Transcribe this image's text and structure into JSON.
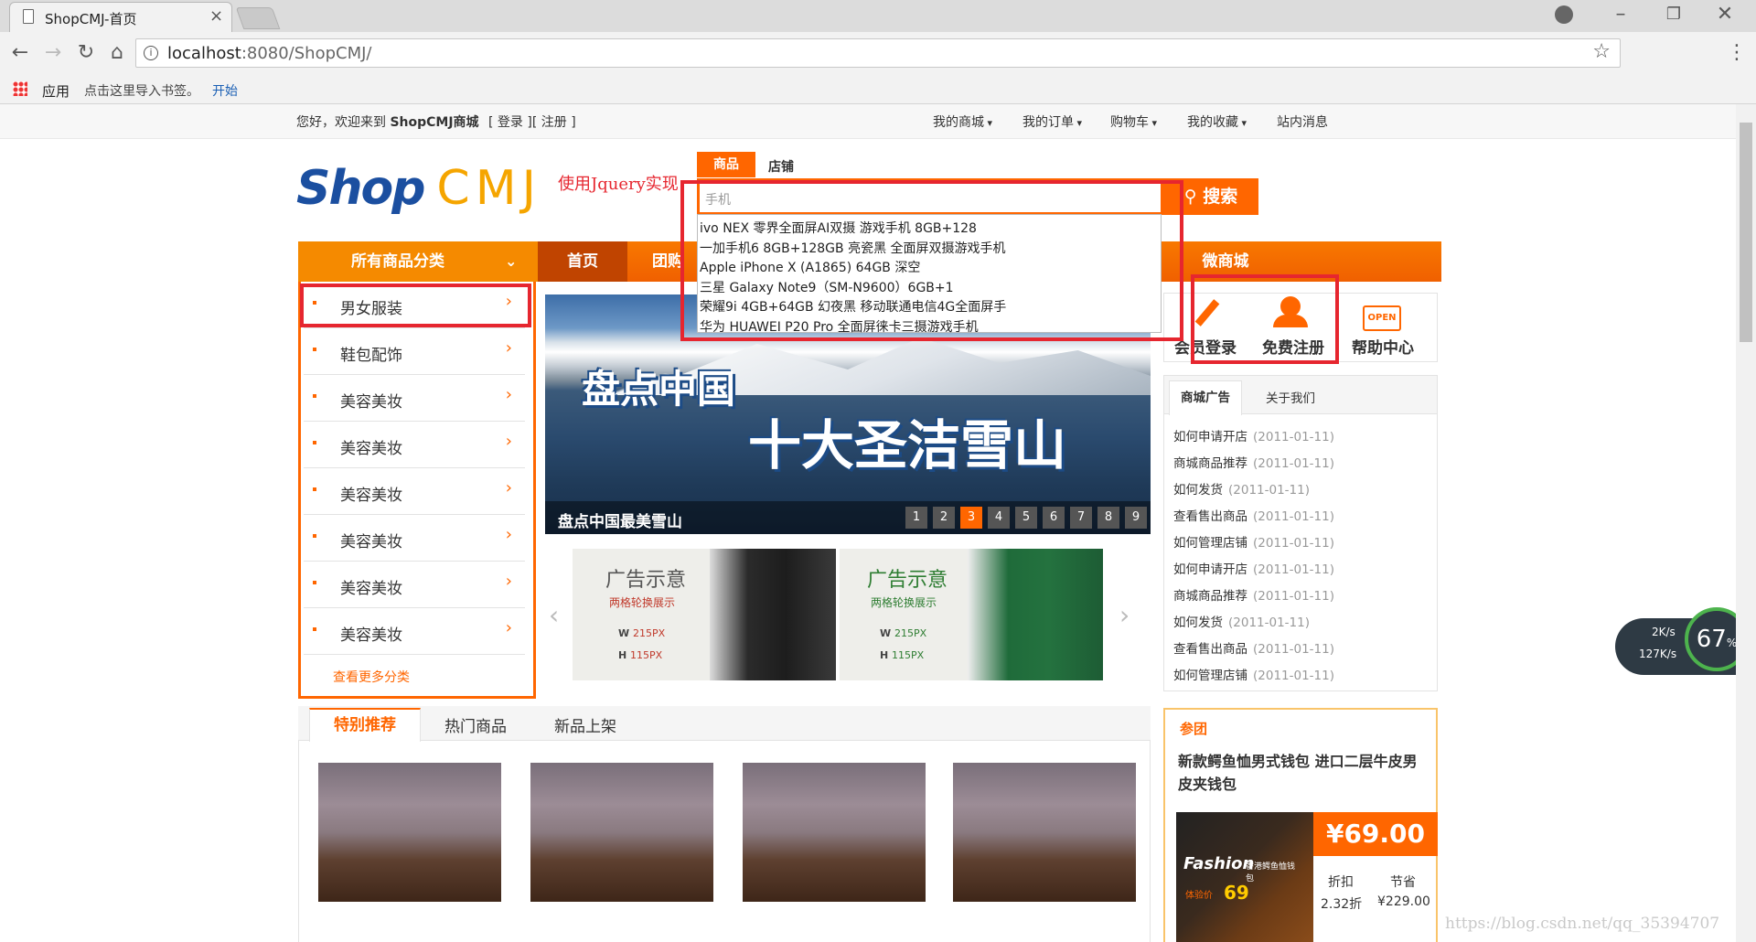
{
  "browser": {
    "tab_title": "ShopCMJ-首页",
    "url_host": "localhost",
    "url_rest": ":8080/ShopCMJ/",
    "bookmarks": [
      "应用",
      "点击这里导入书签。",
      "开始"
    ]
  },
  "sitebar": {
    "welcome": "您好，欢迎来到",
    "site": "ShopCMJ商城",
    "login_reg": "[ 登录 ][ 注册 ]",
    "links": [
      "我的商城",
      "我的订单",
      "购物车",
      "我的收藏",
      "站内消息"
    ]
  },
  "header": {
    "logo_left": "Shop",
    "logo_right": "CMJ",
    "annotation": "使用Jquery实现",
    "search_tabs": [
      "商品",
      "店铺"
    ],
    "search_value": "手机",
    "search_button": "搜索",
    "suggestions": [
      "ivo NEX 零界全面屏AI双摄 游戏手机 8GB+128",
      "一加手机6 8GB+128GB 亮瓷黑 全面屏双摄游戏手机",
      "Apple iPhone X (A1865) 64GB 深空",
      "三星 Galaxy Note9（SM-N9600）6GB+1",
      "荣耀9i 4GB+64GB 幻夜黑 移动联通电信4G全面屏手",
      "华为 HUAWEI P20 Pro 全面屏徕卡三摄游戏手机"
    ]
  },
  "nav": {
    "all_categories": "所有商品分类",
    "items": [
      "首页",
      "团购"
    ],
    "right_item": "微商城"
  },
  "categories": {
    "items": [
      "男女服装",
      "鞋包配饰",
      "美容美妆",
      "美容美妆",
      "美容美妆",
      "美容美妆",
      "美容美妆",
      "美容美妆"
    ],
    "more": "查看更多分类"
  },
  "banner": {
    "title_line1": "盘点中国",
    "title_line2": "十大圣洁雪山",
    "caption": "盘点中国最美雪山",
    "pages": [
      "1",
      "2",
      "3",
      "4",
      "5",
      "6",
      "7",
      "8",
      "9"
    ],
    "active_page": 3
  },
  "ads": [
    {
      "title": "广告示意",
      "subtitle": "两格轮换展示",
      "w": "215PX",
      "h": "115PX"
    },
    {
      "title": "广告示意",
      "subtitle": "两格轮换展示",
      "w": "215PX",
      "h": "115PX"
    }
  ],
  "quick": {
    "items": [
      "会员登录",
      "免费注册",
      "帮助中心"
    ],
    "open_badge": "OPEN"
  },
  "notice": {
    "tabs": [
      "商城广告",
      "关于我们"
    ],
    "items": [
      {
        "title": "如何申请开店",
        "date": "(2011-01-11)"
      },
      {
        "title": "商城商品推荐",
        "date": "(2011-01-11)"
      },
      {
        "title": "如何发货",
        "date": "(2011-01-11)"
      },
      {
        "title": "查看售出商品",
        "date": "(2011-01-11)"
      },
      {
        "title": "如何管理店铺",
        "date": "(2011-01-11)"
      },
      {
        "title": "如何申请开店",
        "date": "(2011-01-11)"
      },
      {
        "title": "商城商品推荐",
        "date": "(2011-01-11)"
      },
      {
        "title": "如何发货",
        "date": "(2011-01-11)"
      },
      {
        "title": "查看售出商品",
        "date": "(2011-01-11)"
      },
      {
        "title": "如何管理店铺",
        "date": "(2011-01-11)"
      }
    ]
  },
  "products": {
    "tabs": [
      "特别推荐",
      "热门商品",
      "新品上架"
    ]
  },
  "promo": {
    "tag": "参团",
    "title": "新款鳄鱼恤男式钱包 进口二层牛皮男皮夹钱包",
    "price": "¥69.00",
    "discount_label": "折扣",
    "discount_value": "2.32折",
    "save_label": "节省",
    "save_value": "¥229.00",
    "img_text": "Fashion",
    "img_sub": "香港鳄鱼恤钱包",
    "img_price_label": "体验价",
    "img_price": "69"
  },
  "widget": {
    "up": "2K/s",
    "down": "127K/s",
    "percent": "67",
    "percent_sign": "%"
  },
  "watermark": "https://blog.csdn.net/qq_35394707"
}
